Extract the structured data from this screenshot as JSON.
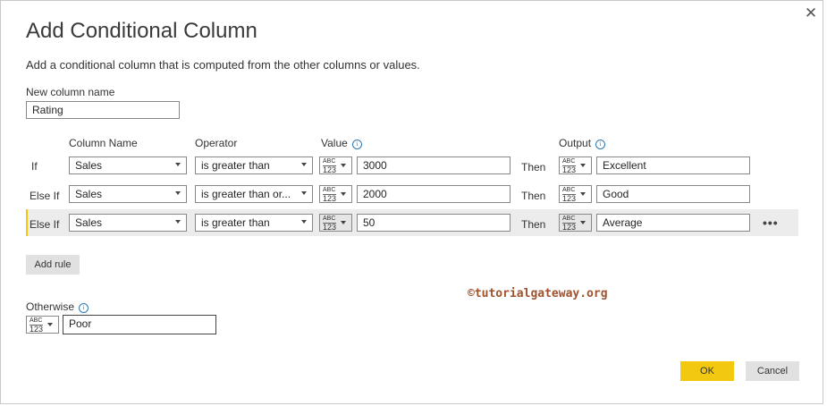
{
  "dialog": {
    "title": "Add Conditional Column",
    "subtitle": "Add a conditional column that is computed from the other columns or values.",
    "close_glyph": "✕"
  },
  "new_column": {
    "label": "New column name",
    "value": "Rating"
  },
  "headers": {
    "column_name": "Column Name",
    "operator": "Operator",
    "value": "Value",
    "output": "Output"
  },
  "type_icon": {
    "top": "ABC",
    "bottom": "123"
  },
  "then_label": "Then",
  "rules": [
    {
      "label": "If",
      "column": "Sales",
      "operator": "is greater than",
      "value": "3000",
      "output": "Excellent"
    },
    {
      "label": "Else If",
      "column": "Sales",
      "operator": "is greater than or...",
      "value": "2000",
      "output": "Good"
    },
    {
      "label": "Else If",
      "column": "Sales",
      "operator": "is greater than",
      "value": "50",
      "output": "Average"
    }
  ],
  "more_glyph": "•••",
  "add_rule_label": "Add rule",
  "otherwise": {
    "label": "Otherwise",
    "value": "Poor"
  },
  "watermark": "©tutorialgateway.org",
  "buttons": {
    "ok": "OK",
    "cancel": "Cancel"
  },
  "colors": {
    "accent": "#f2c811",
    "info": "#2a7ab8",
    "watermark": "#a0522d"
  },
  "icons": {
    "info": "info-icon",
    "close": "close-icon",
    "type": "any-type-icon"
  }
}
